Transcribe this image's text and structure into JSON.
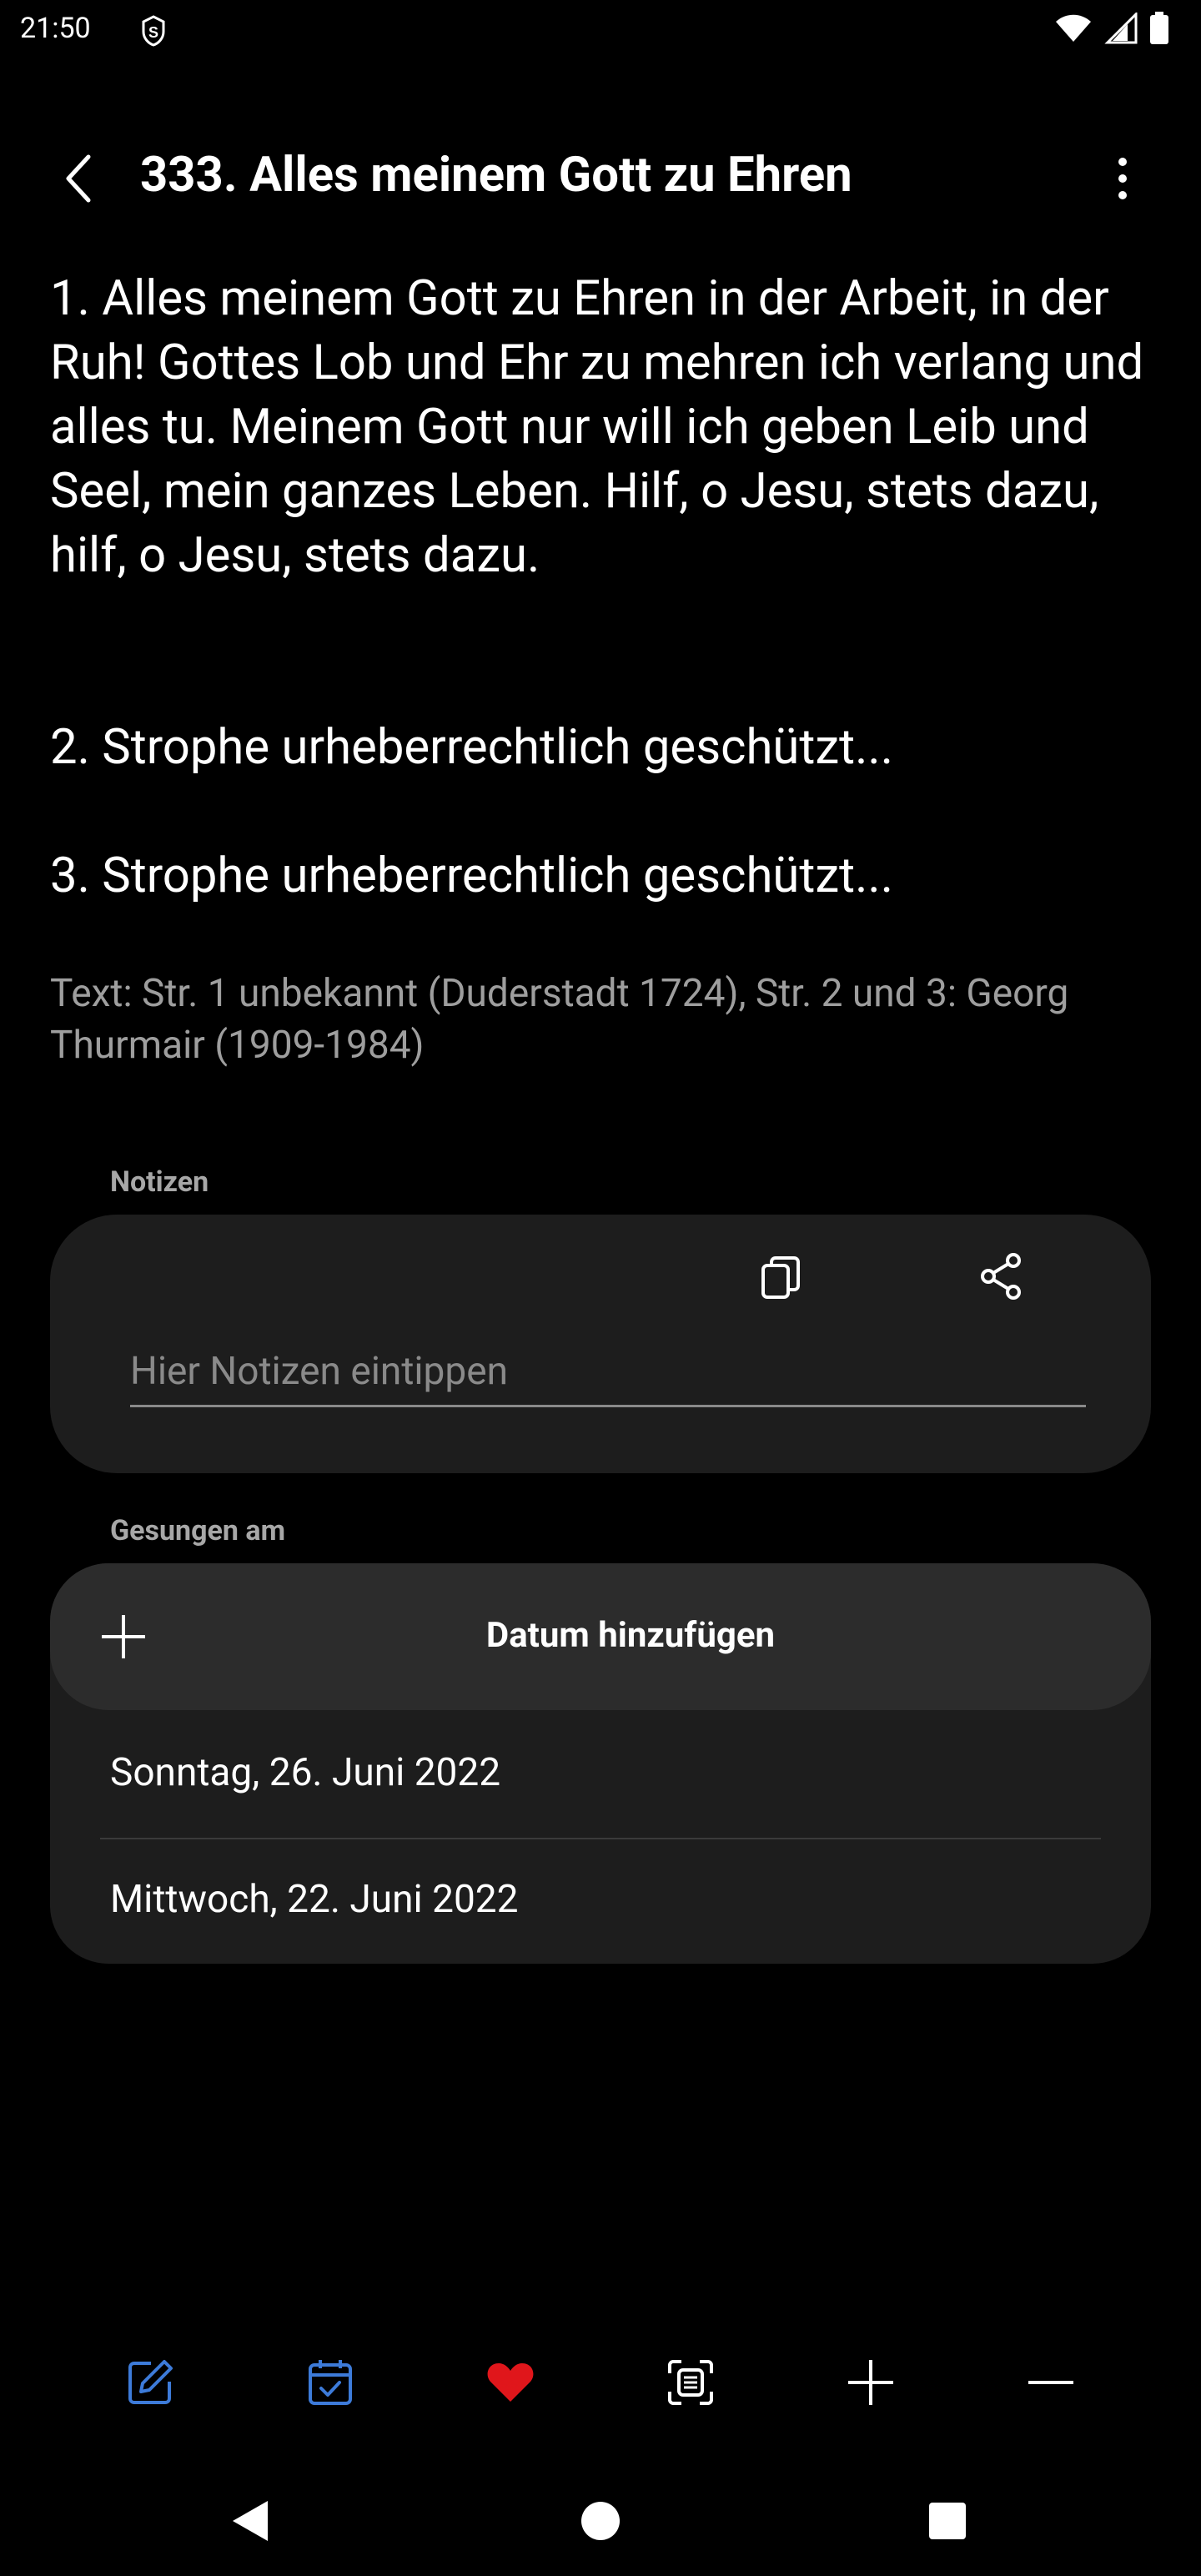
{
  "status_bar": {
    "time": "21:50"
  },
  "app_bar": {
    "title": "333. Alles meinem Gott zu Ehren"
  },
  "lyrics": {
    "verse1": "1. Alles meinem Gott zu Ehren in der Arbeit, in der Ruh! Gottes Lob und Ehr zu mehren ich verlang und alles tu. Meinem Gott nur will ich geben Leib und Seel, mein ganzes Leben. Hilf, o Jesu, stets dazu, hilf, o Jesu, stets dazu.",
    "verse2": "2. Strophe urheberrechtlich geschützt...",
    "verse3": "3. Strophe urheberrechtlich geschützt...",
    "credits": "Text: Str. 1 unbekannt (Duderstadt 1724), Str. 2 und 3: Georg Thurmair (1909-1984)"
  },
  "notes": {
    "label": "Notizen",
    "placeholder": "Hier Notizen eintippen",
    "value": ""
  },
  "sung": {
    "label": "Gesungen am",
    "add_label": "Datum hinzufügen",
    "dates": [
      "Sonntag, 26. Juni 2022",
      "Mittwoch, 22. Juni 2022"
    ]
  },
  "toolbar": {
    "items": [
      "edit-icon",
      "calendar-check-icon",
      "heart-icon",
      "text-scan-icon",
      "plus-icon",
      "minus-icon"
    ]
  },
  "colors": {
    "background": "#000000",
    "card": "#1d1d1d",
    "card_highlight": "#2c2c2c",
    "accent_blue": "#3d7bd9",
    "heart_red": "#e0161b",
    "secondary_text": "#9e9e9e"
  }
}
